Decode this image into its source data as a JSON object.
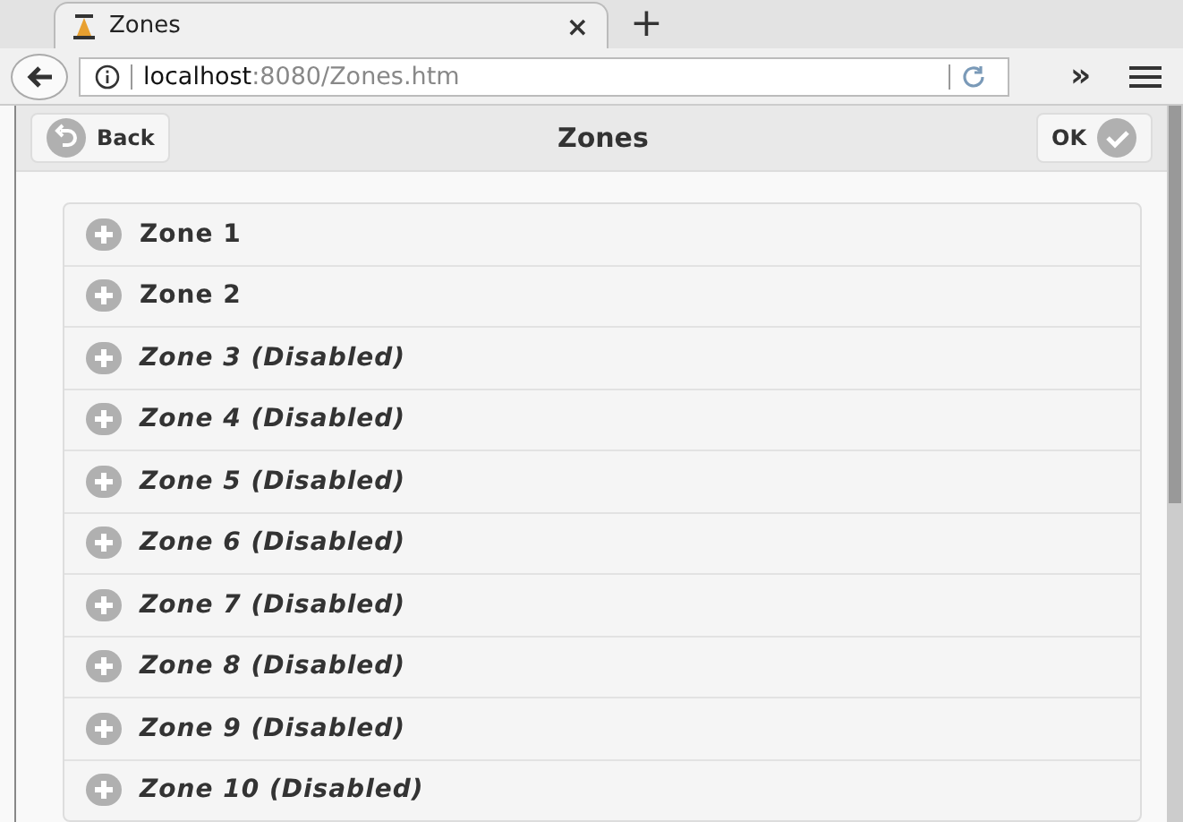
{
  "browser": {
    "tab_title": "Zones",
    "tab_close": "×",
    "new_tab": "+",
    "url_host": "localhost",
    "url_path": ":8080/Zones.htm",
    "overflow": "»"
  },
  "header": {
    "back": "Back",
    "title": "Zones",
    "ok": "OK"
  },
  "zones": [
    {
      "label": "Zone 1",
      "disabled": false
    },
    {
      "label": "Zone 2",
      "disabled": false
    },
    {
      "label": "Zone 3 (Disabled)",
      "disabled": true
    },
    {
      "label": "Zone 4 (Disabled)",
      "disabled": true
    },
    {
      "label": "Zone 5 (Disabled)",
      "disabled": true
    },
    {
      "label": "Zone 6 (Disabled)",
      "disabled": true
    },
    {
      "label": "Zone 7 (Disabled)",
      "disabled": true
    },
    {
      "label": "Zone 8 (Disabled)",
      "disabled": true
    },
    {
      "label": "Zone 9 (Disabled)",
      "disabled": true
    },
    {
      "label": "Zone 10 (Disabled)",
      "disabled": true
    }
  ]
}
